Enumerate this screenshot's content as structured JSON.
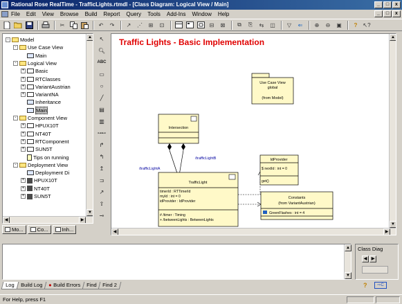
{
  "window": {
    "title": "Rational Rose RealTime - TrafficLights.rtmdl - [Class Diagram: Logical View / Main]",
    "controls": [
      "_",
      "□",
      "x"
    ]
  },
  "menu": [
    "File",
    "Edit",
    "View",
    "Browse",
    "Build",
    "Report",
    "Query",
    "Tools",
    "Add-Ins",
    "Window",
    "Help"
  ],
  "browser": {
    "tree": [
      {
        "label": "Model",
        "depth": 0,
        "expander": "-",
        "icon": "model"
      },
      {
        "label": "Use Case View",
        "depth": 1,
        "expander": "-",
        "icon": "folder"
      },
      {
        "label": "Main",
        "depth": 2,
        "expander": "",
        "icon": "diagram"
      },
      {
        "label": "Logical View",
        "depth": 1,
        "expander": "-",
        "icon": "folder"
      },
      {
        "label": "Basic",
        "depth": 2,
        "expander": "+",
        "icon": "package"
      },
      {
        "label": "RTClasses",
        "depth": 2,
        "expander": "+",
        "icon": "package"
      },
      {
        "label": "VariantAustrian",
        "depth": 2,
        "expander": "+",
        "icon": "package"
      },
      {
        "label": "VariantNA",
        "depth": 2,
        "expander": "+",
        "icon": "package"
      },
      {
        "label": "Inheritance",
        "depth": 2,
        "expander": "",
        "icon": "diagram"
      },
      {
        "label": "Main",
        "depth": 2,
        "expander": "",
        "icon": "diagram",
        "selected": true
      },
      {
        "label": "Component View",
        "depth": 1,
        "expander": "-",
        "icon": "folder"
      },
      {
        "label": "HPUX10T",
        "depth": 2,
        "expander": "+",
        "icon": "package"
      },
      {
        "label": "NT40T",
        "depth": 2,
        "expander": "+",
        "icon": "package"
      },
      {
        "label": "RTComponent",
        "depth": 2,
        "expander": "+",
        "icon": "package"
      },
      {
        "label": "SUN5T",
        "depth": 2,
        "expander": "+",
        "icon": "package"
      },
      {
        "label": "Tips on running",
        "depth": 2,
        "expander": "",
        "icon": "note"
      },
      {
        "label": "Deployment View",
        "depth": 1,
        "expander": "-",
        "icon": "folder"
      },
      {
        "label": "Deployment Di",
        "depth": 2,
        "expander": "",
        "icon": "diagram"
      },
      {
        "label": "HPUX10T",
        "depth": 2,
        "expander": "+",
        "icon": "cube"
      },
      {
        "label": "NT40T",
        "depth": 2,
        "expander": "+",
        "icon": "cube"
      },
      {
        "label": "SUN5T",
        "depth": 2,
        "expander": "+",
        "icon": "cube"
      }
    ],
    "tabs": [
      "Mo...",
      "Co...",
      "Inh..."
    ]
  },
  "diagram": {
    "title": "Traffic Lights - Basic Implementation",
    "title_color": "#e00000",
    "packages": [
      {
        "lines": [
          "Use Case View",
          "global",
          "",
          "(from Model)"
        ]
      }
    ],
    "classes": {
      "intersection": {
        "name": "Intersection"
      },
      "trafficlight": {
        "name": "TrafficLight",
        "attributes": [
          "timerId : RTTimerId",
          "myId : int = 0",
          "idProvider : IdProvider"
        ],
        "operations": [
          "# /timer : Timing",
          "+ /betweenLights : BetweenLights"
        ]
      },
      "idprovider": {
        "name": "IdProvider",
        "attributes": [
          "$ nextId : int = 0"
        ],
        "operations": [
          "get()"
        ]
      },
      "constants": {
        "name": "Constants",
        "subtitle": "(from VariantAustrian)",
        "attributes": [
          "GreenFlashes : int = 4"
        ]
      }
    },
    "roles": {
      "trafficlight_b": "/trafficLightB",
      "trafficlight_a": "/trafficLightA"
    }
  },
  "log_tabs": [
    "Log",
    "Build Log",
    "Build Errors",
    "Find",
    "Find 2"
  ],
  "class_panel": {
    "title": "Class Diag"
  },
  "status": "For Help, press F1"
}
